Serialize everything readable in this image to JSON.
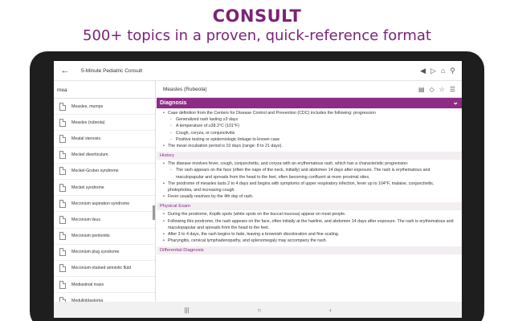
{
  "promo": {
    "title": "CONSULT",
    "subtitle": "500+ topics in a proven, quick-reference format"
  },
  "appbar": {
    "title": "5-Minute Pediatric Consult",
    "back_icon": "◀"
  },
  "sidebar": {
    "search_value": "mea",
    "topics": [
      "Measles, mumps",
      "Measles (rubeola)",
      "Meatal stenosis",
      "Meckel diverticulum",
      "Meckel-Gruber syndrome",
      "Meckel syndrome",
      "Meconium aspiration syndrome",
      "Meconium ileus",
      "Meconium peritonitis",
      "Meconium plug syndrome",
      "Meconium-stained amniotic fluid",
      "Mediastinal mass",
      "Medulloblastoma"
    ]
  },
  "content": {
    "title": "Measles (Rubeola)",
    "diagnosis_header": "Diagnosis",
    "definition_items": [
      "Case definition from the Centers for Disease Control and Prevention (CDC) includes the following: progression"
    ],
    "definition_sub": [
      "Generalized rash lasting ≥3 days",
      "A temperature of ≥38.3°C (101°F)",
      "Cough, coryza, or conjunctivitis",
      "Positive testing or epidemiologic linkage to known case"
    ],
    "incubation": "The mean incubation period is 10 days (range: 8 to 21 days).",
    "history_header": "History",
    "history_items": [
      "The disease involves fever, cough, conjunctivitis, and coryza with an erythematous rash, which has a characteristic progression:"
    ],
    "history_sub": [
      "The rash appears on the face (often the nape of the neck, initially) and abdomen 14 days after exposure. The rash is erythematous and maculopapular and spreads from the head to the feet, often becoming confluent at more proximal sites."
    ],
    "history_items2": [
      "The prodrome of measles lasts 2 to 4 days and begins with symptoms of upper respiratory infection, fever up to 104°F, malaise, conjunctivitis, photophobia, and increasing cough.",
      "Fever usually resolves by the 4th day of rash."
    ],
    "exam_header": "Physical Exam",
    "exam_items": [
      "During the prodrome, Koplik spots (white spots on the buccal mucosa) appear on most people.",
      "Following this prodrome, the rash appears on the face, often initially at the hairline, and abdomen 14 days after exposure. The rash is erythematous and maculopapular and spreads from the head to the feet.",
      "After 3 to 4 days, the rash begins to fade, leaving a brownish discoloration and fine scaling.",
      "Pharyngitis, cervical lymphadenopathy, and splenomegaly may accompany the rash."
    ],
    "diff_header": "Differential Diagnosis"
  },
  "navbar": {
    "recents": "|||",
    "home": "○",
    "back": "‹"
  }
}
